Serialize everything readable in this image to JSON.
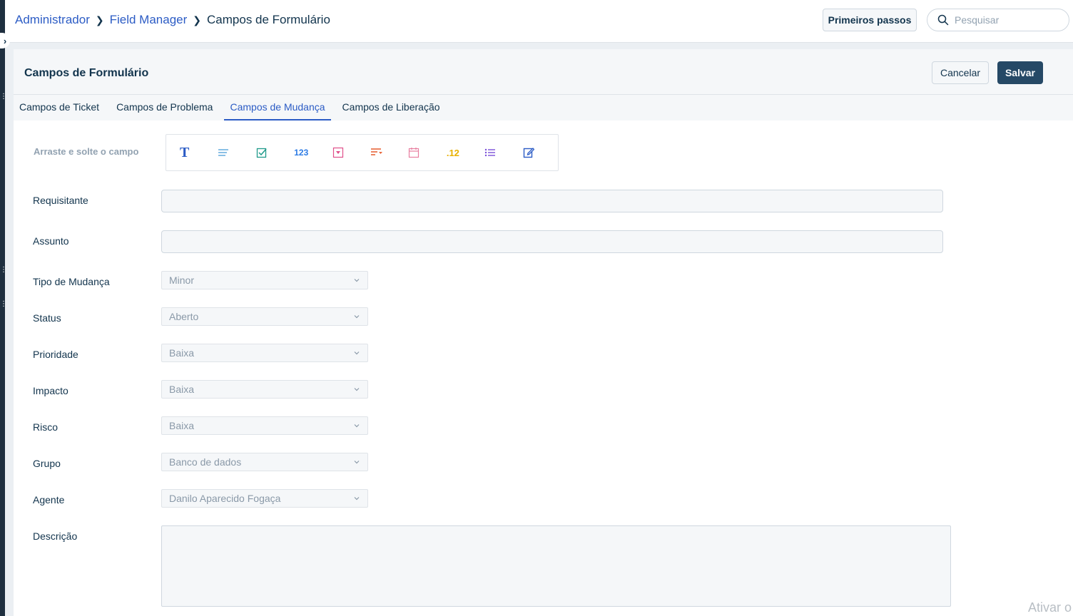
{
  "breadcrumb": {
    "items": [
      "Administrador",
      "Field Manager"
    ],
    "current": "Campos de Formulário"
  },
  "header": {
    "getting_started": "Primeiros passos",
    "search_placeholder": "Pesquisar"
  },
  "card": {
    "title": "Campos de Formulário",
    "cancel_label": "Cancelar",
    "save_label": "Salvar"
  },
  "tabs": [
    {
      "label": "Campos de Ticket",
      "active": false
    },
    {
      "label": "Campos de Problema",
      "active": false
    },
    {
      "label": "Campos de Mudança",
      "active": true
    },
    {
      "label": "Campos de Liberação",
      "active": false
    }
  ],
  "palette": {
    "label": "Arraste e solte o campo",
    "items": [
      {
        "icon": "single-line-text-icon",
        "glyph": "T",
        "color": "#2c5cc5"
      },
      {
        "icon": "paragraph-icon",
        "glyph": "",
        "color": "#4a9fd8"
      },
      {
        "icon": "checkbox-icon",
        "glyph": "",
        "color": "#1f9a8a"
      },
      {
        "icon": "number-icon",
        "glyph": "123",
        "color": "#2c7be5"
      },
      {
        "icon": "dropdown-icon",
        "glyph": "",
        "color": "#e04f8a"
      },
      {
        "icon": "dependent-field-icon",
        "glyph": "",
        "color": "#e8663a"
      },
      {
        "icon": "date-icon",
        "glyph": "",
        "color": "#e87fa0"
      },
      {
        "icon": "decimal-icon",
        "glyph": ".12",
        "color": "#e8b100"
      },
      {
        "icon": "multi-select-icon",
        "glyph": "",
        "color": "#7a4fd8"
      },
      {
        "icon": "custom-text-icon",
        "glyph": "",
        "color": "#2c5cc5"
      }
    ]
  },
  "fields": {
    "requester": {
      "label": "Requisitante"
    },
    "subject": {
      "label": "Assunto"
    },
    "change_type": {
      "label": "Tipo de Mudança",
      "value": "Minor"
    },
    "status": {
      "label": "Status",
      "value": "Aberto"
    },
    "priority": {
      "label": "Prioridade",
      "value": "Baixa"
    },
    "impact": {
      "label": "Impacto",
      "value": "Baixa"
    },
    "risk": {
      "label": "Risco",
      "value": "Baixa"
    },
    "group": {
      "label": "Grupo",
      "value": "Banco de dados"
    },
    "agent": {
      "label": "Agente",
      "value": "Danilo Aparecido Fogaça"
    },
    "description": {
      "label": "Descrição"
    }
  },
  "watermark": "Ativar o"
}
